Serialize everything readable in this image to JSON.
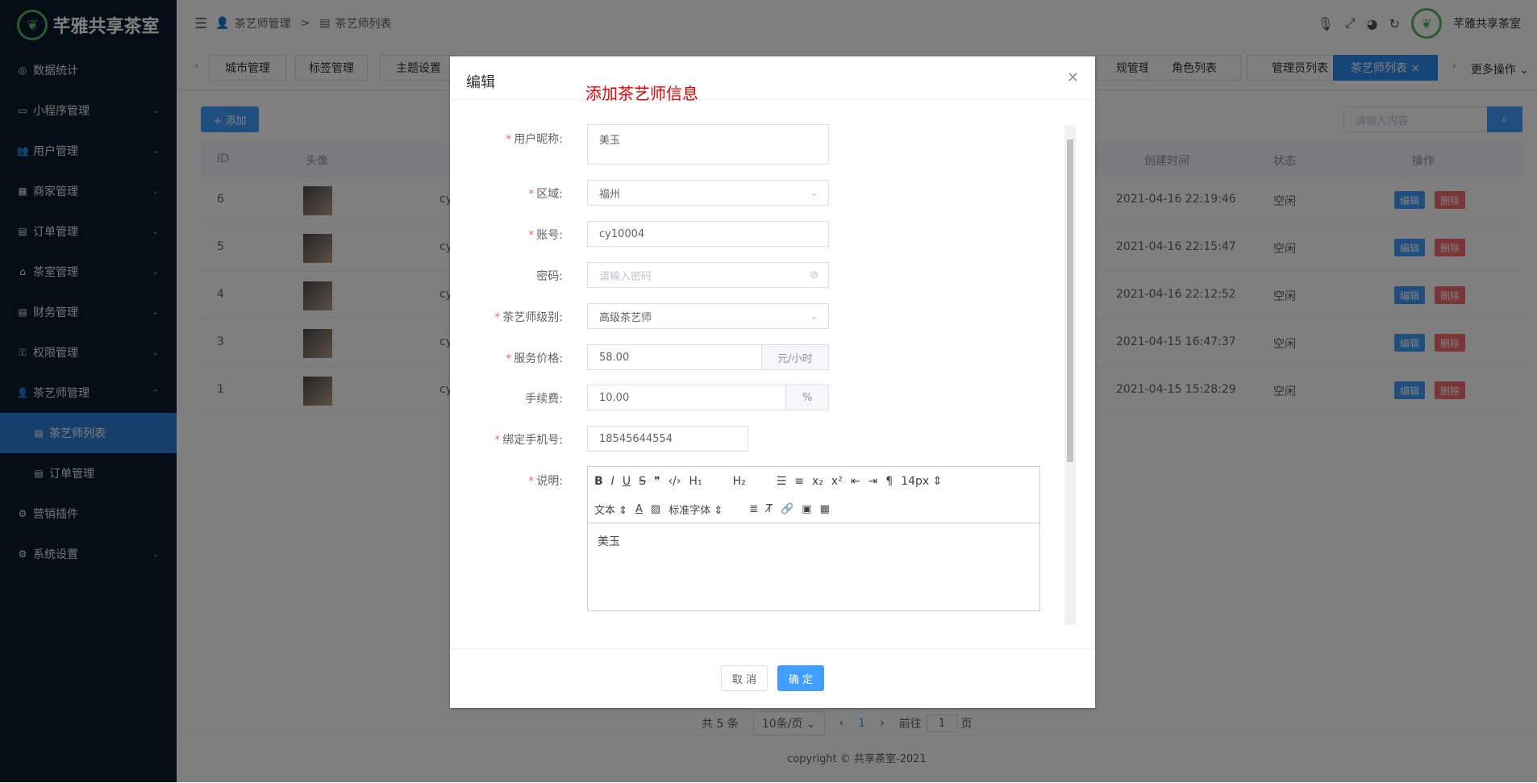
{
  "app": {
    "brand": "芊雅共享茶室"
  },
  "sidebar": {
    "items": [
      {
        "label": "数据统计",
        "icon": "dashboard-icon",
        "chevron": false
      },
      {
        "label": "小程序管理",
        "icon": "monitor-icon",
        "chevron": true
      },
      {
        "label": "用户管理",
        "icon": "users-icon",
        "chevron": true
      },
      {
        "label": "商家管理",
        "icon": "store-icon",
        "chevron": true
      },
      {
        "label": "订单管理",
        "icon": "clipboard-icon",
        "chevron": true
      },
      {
        "label": "茶室管理",
        "icon": "home-icon",
        "chevron": true
      },
      {
        "label": "财务管理",
        "icon": "finance-icon",
        "chevron": true
      },
      {
        "label": "权限管理",
        "icon": "key-icon",
        "chevron": true
      },
      {
        "label": "茶艺师管理",
        "icon": "user-icon",
        "chevron": true
      },
      {
        "label": "茶艺师列表",
        "icon": "list-icon",
        "chevron": false
      },
      {
        "label": "订单管理",
        "icon": "clipboard-icon",
        "chevron": false
      },
      {
        "label": "营销插件",
        "icon": "plugin-icon",
        "chevron": false
      },
      {
        "label": "系统设置",
        "icon": "gear-icon",
        "chevron": true
      }
    ]
  },
  "breadcrumb": {
    "parent": "茶艺师管理",
    "sep": ">",
    "current": "茶艺师列表"
  },
  "topbar": {
    "user": "芊雅共享茶室"
  },
  "tabs": [
    {
      "label": "城市管理"
    },
    {
      "label": "标签管理"
    },
    {
      "label": "主题设置"
    },
    {
      "label": "规管理"
    },
    {
      "label": "角色列表"
    },
    {
      "label": "管理员列表"
    },
    {
      "label": "茶艺师列表 ×"
    }
  ],
  "tabs_more": "更多操作",
  "toolbar": {
    "add_label": "+ 添加",
    "search_placeholder": "请输入内容"
  },
  "table": {
    "headers": {
      "id": "ID",
      "avatar": "头像",
      "created": "创建时间",
      "status": "状态",
      "ops": "操作"
    },
    "rows": [
      {
        "id": "6",
        "acct": "cy",
        "created": "2021-04-16 22:19:46",
        "status": "空闲"
      },
      {
        "id": "5",
        "acct": "cy",
        "created": "2021-04-16 22:15:47",
        "status": "空闲"
      },
      {
        "id": "4",
        "acct": "cy",
        "created": "2021-04-16 22:12:52",
        "status": "空闲"
      },
      {
        "id": "3",
        "acct": "cy",
        "created": "2021-04-15 16:47:37",
        "status": "空闲"
      },
      {
        "id": "1",
        "acct": "cy",
        "created": "2021-04-15 15:28:29",
        "status": "空闲"
      }
    ],
    "edit_label": "编辑",
    "delete_label": "删除"
  },
  "pager": {
    "total": "共 5 条",
    "size": "10条/页",
    "page": "1",
    "goto": "前往",
    "goto_val": "1",
    "page_unit": "页"
  },
  "footer": "copyright © 共享茶室-2021",
  "dialog": {
    "title": "编辑",
    "annotation": "添加茶艺师信息",
    "fields": {
      "nickname": {
        "label": "用户昵称:",
        "value": "美玉"
      },
      "region": {
        "label": "区域:",
        "value": "福州"
      },
      "account": {
        "label": "账号:",
        "value": "cy10004"
      },
      "password": {
        "label": "密码:",
        "placeholder": "请输入密码"
      },
      "level": {
        "label": "茶艺师级别:",
        "value": "高级茶艺师"
      },
      "price": {
        "label": "服务价格:",
        "value": "58.00",
        "unit": "元/小时"
      },
      "fee": {
        "label": "手续费:",
        "value": "10.00",
        "unit": "%"
      },
      "phone": {
        "label": "绑定手机号:",
        "value": "18545644554"
      },
      "desc": {
        "label": "说明:",
        "value": "美玉"
      }
    },
    "editor": {
      "size": "14px",
      "text_style": "文本",
      "font": "标准字体"
    },
    "cancel": "取 消",
    "confirm": "确 定"
  },
  "colors": {
    "primary": "#409eff",
    "danger": "#f56c6c",
    "sidebar": "#0a1a2f"
  }
}
